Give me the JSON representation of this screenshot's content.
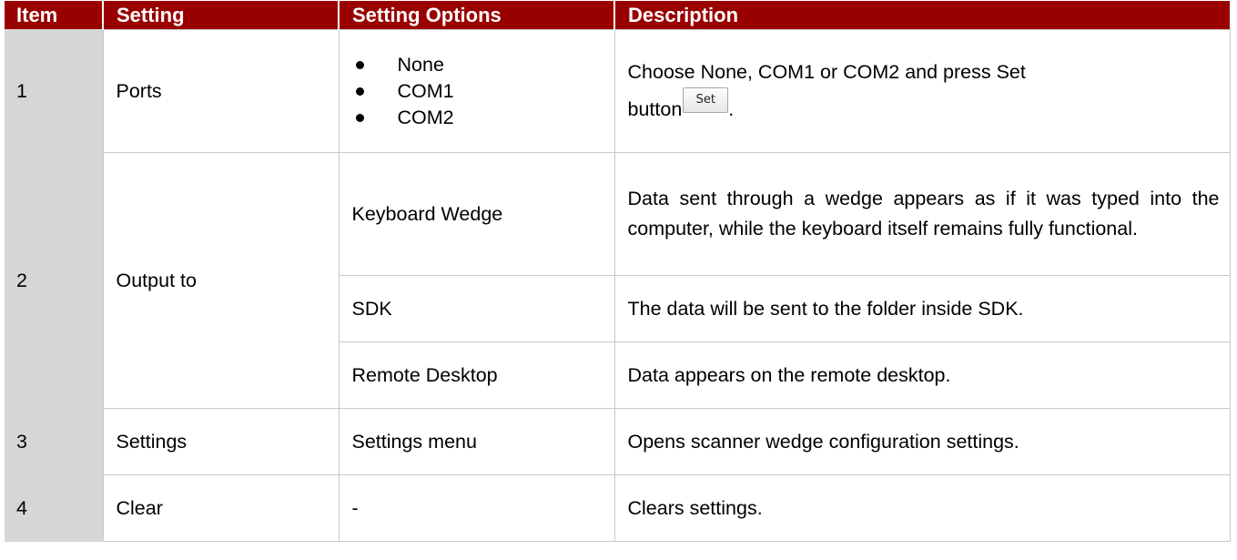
{
  "headers": {
    "item": "Item",
    "setting": "Setting",
    "options": "Setting Options",
    "description": "Description"
  },
  "row1": {
    "item": "1",
    "setting": "Ports",
    "options": [
      "None",
      "COM1",
      "COM2"
    ],
    "description_line1": "Choose None, COM1 or COM2 and press Set",
    "description_line2": "button",
    "button_label": "Set",
    "description_end": "."
  },
  "row2": {
    "item": "2",
    "setting": "Output to",
    "sub": [
      {
        "option": "Keyboard Wedge",
        "description": "Data sent through a wedge appears as if it was typed into the computer, while the keyboard itself remains fully functional."
      },
      {
        "option": "SDK",
        "description": "The data will be sent to the folder inside SDK."
      },
      {
        "option": "Remote Desktop",
        "description": "Data appears on the remote desktop."
      }
    ]
  },
  "row3": {
    "item": "3",
    "setting": "Settings",
    "option": "Settings menu",
    "description": "Opens scanner wedge configuration settings."
  },
  "row4": {
    "item": "4",
    "setting": "Clear",
    "option": "-",
    "description": "Clears settings."
  }
}
